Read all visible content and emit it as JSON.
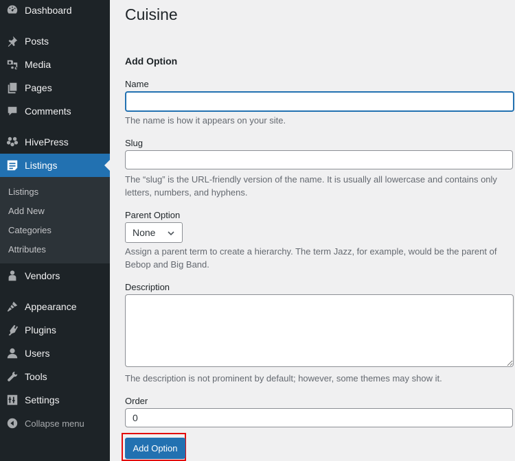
{
  "sidebar": {
    "items": [
      {
        "label": "Dashboard",
        "icon": "dashboard-icon"
      },
      {
        "label": "Posts",
        "icon": "pin-icon"
      },
      {
        "label": "Media",
        "icon": "media-icon"
      },
      {
        "label": "Pages",
        "icon": "pages-icon"
      },
      {
        "label": "Comments",
        "icon": "comment-icon"
      },
      {
        "label": "HivePress",
        "icon": "hivepress-icon"
      },
      {
        "label": "Listings",
        "icon": "listings-icon",
        "active": true
      },
      {
        "label": "Vendors",
        "icon": "vendor-icon"
      },
      {
        "label": "Appearance",
        "icon": "brush-icon"
      },
      {
        "label": "Plugins",
        "icon": "plugin-icon"
      },
      {
        "label": "Users",
        "icon": "user-icon"
      },
      {
        "label": "Tools",
        "icon": "wrench-icon"
      },
      {
        "label": "Settings",
        "icon": "settings-icon"
      }
    ],
    "submenu": [
      "Listings",
      "Add New",
      "Categories",
      "Attributes"
    ],
    "collapse_label": "Collapse menu"
  },
  "page": {
    "title": "Cuisine",
    "section_title": "Add Option",
    "name": {
      "label": "Name",
      "value": "",
      "help": "The name is how it appears on your site."
    },
    "slug": {
      "label": "Slug",
      "value": "",
      "help": "The “slug” is the URL-friendly version of the name. It is usually all lowercase and contains only letters, numbers, and hyphens."
    },
    "parent": {
      "label": "Parent Option",
      "selected": "None",
      "help": "Assign a parent term to create a hierarchy. The term Jazz, for example, would be the parent of Bebop and Big Band."
    },
    "description": {
      "label": "Description",
      "value": "",
      "help": "The description is not prominent by default; however, some themes may show it."
    },
    "order": {
      "label": "Order",
      "value": "0"
    },
    "submit_label": "Add Option"
  },
  "colors": {
    "accent": "#2271b1",
    "sidebar": "#1d2327",
    "highlight": "#e30c0c"
  }
}
